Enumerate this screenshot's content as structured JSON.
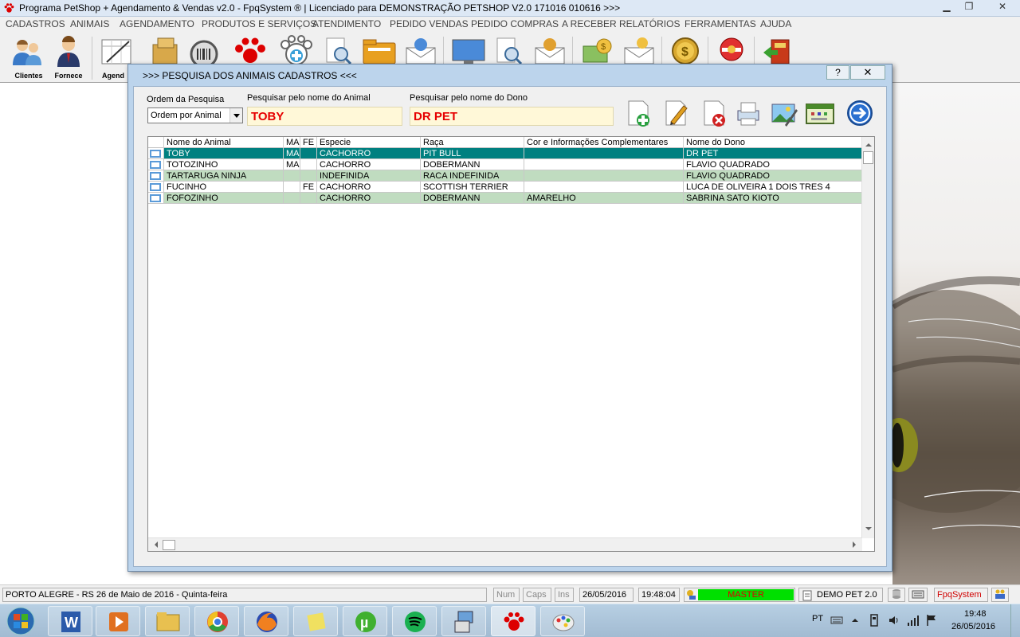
{
  "window": {
    "title": "Programa PetShop + Agendamento & Vendas v2.0 - FpqSystem ® | Licenciado para  DEMONSTRAÇÃO PETSHOP V2.0 171016 010616 >>>"
  },
  "menu": [
    "CADASTROS",
    "ANIMAIS",
    "AGENDAMENTO",
    "PRODUTOS E SERVIÇOS",
    "ATENDIMENTO",
    "PEDIDO VENDAS",
    "PEDIDO COMPRAS",
    "A RECEBER",
    "RELATÓRIOS",
    "FERRAMENTAS",
    "AJUDA"
  ],
  "toolbar": {
    "clientes": "Clientes",
    "fornece": "Fornece",
    "agenda": "Agend"
  },
  "dialog": {
    "title": ">>>  PESQUISA DOS ANIMAIS CADASTROS  <<<",
    "help": "?",
    "close": "✕",
    "order_label": "Ordem da Pesquisa",
    "order_value": "Ordem por Animal",
    "animal_label": "Pesquisar pelo nome do Animal",
    "animal_value": "TOBY",
    "owner_label": "Pesquisar pelo nome do Dono",
    "owner_value": "DR PET"
  },
  "grid": {
    "columns": [
      "Nome do Animal",
      "MA",
      "FE",
      "Especie",
      "Raça",
      "Cor e Informações Complementares",
      "Nome do Dono"
    ],
    "rows": [
      [
        "TOBY",
        "MA",
        "",
        "CACHORRO",
        "PIT BULL",
        "",
        "DR PET"
      ],
      [
        "TOTOZINHO",
        "MA",
        "",
        "CACHORRO",
        "DOBERMANN",
        "",
        "FLAVIO QUADRADO"
      ],
      [
        "TARTARUGA NINJA",
        "",
        "",
        "INDEFINIDA",
        "RACA INDEFINIDA",
        "",
        "FLAVIO QUADRADO"
      ],
      [
        "FUCINHO",
        "",
        "FE",
        "CACHORRO",
        "SCOTTISH TERRIER",
        "",
        "LUCA DE OLIVEIRA 1 DOIS TRES 4"
      ],
      [
        "FOFOZINHO",
        "",
        "",
        "CACHORRO",
        "DOBERMANN",
        "AMARELHO",
        "SABRINA SATO KIOTO"
      ]
    ]
  },
  "status": {
    "location": "PORTO ALEGRE - RS 26 de Maio de 2016 - Quinta-feira",
    "num": "Num",
    "caps": "Caps",
    "ins": "Ins",
    "date": "26/05/2016",
    "time": "19:48:04",
    "user": "MASTER",
    "demo": "DEMO PET 2.0",
    "brand": "FpqSystem"
  },
  "taskbar": {
    "lang": "PT",
    "time": "19:48",
    "date": "26/05/2016"
  },
  "colors": {
    "selected_row": "#008080",
    "alt_row": "#c0dcc0",
    "user_green": "#00e000",
    "brand_red": "#d00000",
    "input_red": "#e60000"
  }
}
